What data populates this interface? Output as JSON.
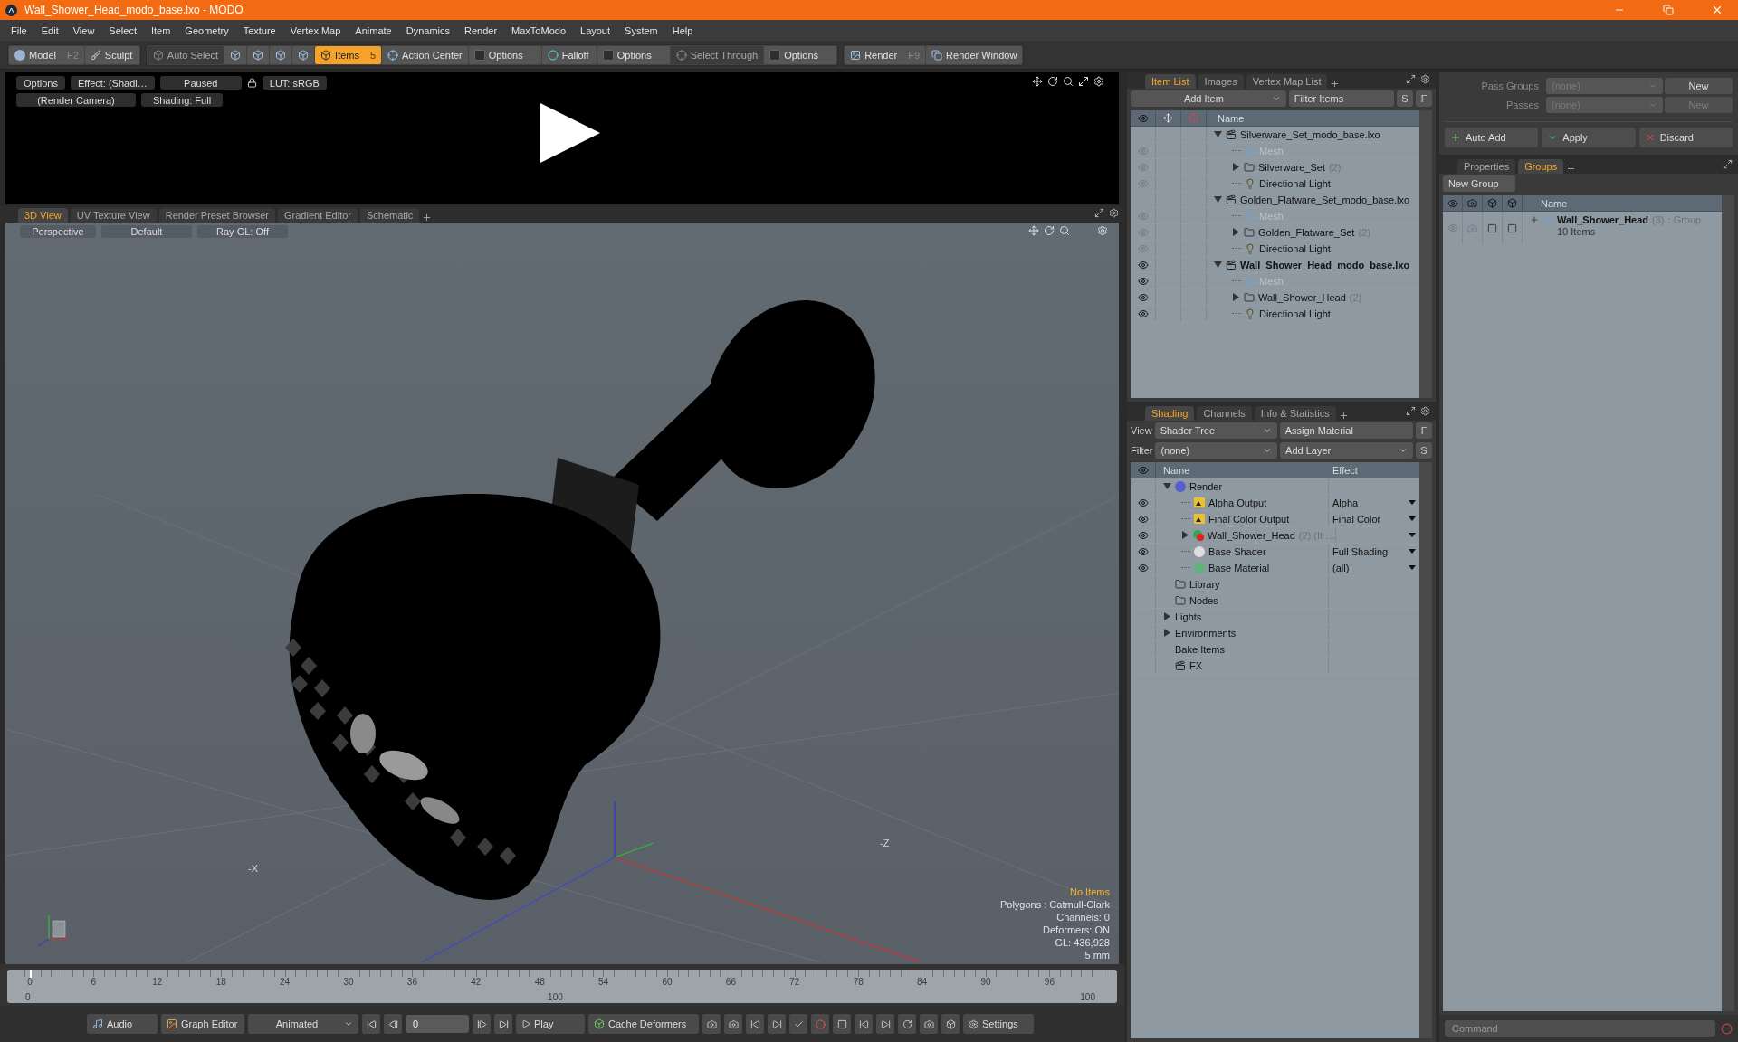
{
  "window": {
    "title": "Wall_Shower_Head_modo_base.lxo - MODO"
  },
  "menu": [
    "File",
    "Edit",
    "View",
    "Select",
    "Item",
    "Geometry",
    "Texture",
    "Vertex Map",
    "Animate",
    "Dynamics",
    "Render",
    "MaxToModo",
    "Layout",
    "System",
    "Help"
  ],
  "toolbar": [
    [
      {
        "kind": "mode",
        "label": "Model",
        "shortcut": "F2",
        "selected": false,
        "disabled": false
      },
      {
        "kind": "brush",
        "label": "Sculpt",
        "selected": false,
        "disabled": false
      }
    ],
    [
      {
        "kind": "auto-select",
        "label": "Auto Select",
        "selected": false,
        "disabled": true
      },
      {
        "kind": "vertex",
        "selected": false,
        "disabled": false
      },
      {
        "kind": "edge",
        "selected": false,
        "disabled": false
      },
      {
        "kind": "polygon",
        "selected": false,
        "disabled": false
      },
      {
        "kind": "material",
        "selected": false,
        "disabled": false
      },
      {
        "kind": "items",
        "label": "Items",
        "shortcut": "5",
        "selected": true,
        "disabled": false
      },
      {
        "kind": "action-center",
        "label": "Action Center",
        "selected": false,
        "disabled": false
      },
      {
        "kind": "options",
        "label": "Options",
        "selected": false,
        "disabled": false
      },
      {
        "kind": "falloff",
        "label": "Falloff",
        "selected": false,
        "disabled": false
      },
      {
        "kind": "options",
        "label": "Options",
        "selected": false,
        "disabled": false
      },
      {
        "kind": "select-through",
        "label": "Select Through",
        "selected": false,
        "disabled": true
      },
      {
        "kind": "options",
        "label": "Options",
        "selected": false,
        "disabled": false
      }
    ],
    [
      {
        "kind": "render",
        "label": "Render",
        "shortcut": "F9",
        "selected": false,
        "disabled": false
      },
      {
        "kind": "render-window",
        "label": "Render Window",
        "selected": false,
        "disabled": false
      }
    ]
  ],
  "preview": {
    "top_buttons": [
      "Options",
      "Effect: (Shadi…",
      "Paused",
      "LUT: sRGB"
    ],
    "bottom_buttons": [
      "(Render Camera)",
      "Shading: Full"
    ]
  },
  "viewport_tabs": [
    {
      "label": "3D View",
      "selected": true
    },
    {
      "label": "UV Texture View",
      "selected": false
    },
    {
      "label": "Render Preset Browser",
      "selected": false
    },
    {
      "label": "Gradient Editor",
      "selected": false
    },
    {
      "label": "Schematic",
      "selected": false
    }
  ],
  "viewport": {
    "buttons": [
      "Perspective",
      "Default",
      "Ray GL: Off"
    ],
    "axis_labels": [
      "-X",
      "-Z"
    ],
    "stats": [
      {
        "kind": "warning",
        "text": "No Items"
      },
      {
        "kind": "info",
        "text": "Polygons : Catmull-Clark"
      },
      {
        "kind": "info",
        "text": "Channels: 0"
      },
      {
        "kind": "info",
        "text": "Deformers: ON"
      },
      {
        "kind": "info",
        "text": "GL: 436,928"
      },
      {
        "kind": "info",
        "text": "5 mm"
      }
    ]
  },
  "timeline": {
    "ticks": [
      "0",
      "6",
      "12",
      "18",
      "24",
      "30",
      "36",
      "42",
      "48",
      "54",
      "60",
      "66",
      "72",
      "78",
      "84",
      "90",
      "96"
    ],
    "lower_ticks": [
      "0",
      "100",
      "100"
    ]
  },
  "bottom_bar": {
    "audio": "Audio",
    "graph_editor": "Graph Editor",
    "mode": "Animated",
    "frame": "0",
    "play": "Play",
    "cache": "Cache Deformers",
    "settings": "Settings"
  },
  "item_list": {
    "tabs": [
      {
        "label": "Item List",
        "selected": true
      },
      {
        "label": "Images",
        "selected": false
      },
      {
        "label": "Vertex Map List",
        "selected": false
      }
    ],
    "add_item": "Add Item",
    "filter": "Filter Items",
    "s": "S",
    "f": "F",
    "column": "Name",
    "items": [
      {
        "kind": "scene",
        "label": "Silverware_Set_modo_base.lxo",
        "current": false,
        "expanded": true,
        "children": [
          {
            "kind": "mesh",
            "label": "Mesh",
            "visible": false,
            "disabled": true
          },
          {
            "kind": "group",
            "label": "Silverware_Set",
            "count": "(2)",
            "visible": false,
            "disabled": false,
            "expanded": false
          },
          {
            "kind": "light",
            "label": "Directional Light",
            "visible": false,
            "disabled": false
          }
        ]
      },
      {
        "kind": "scene",
        "label": "Golden_Flatware_Set_modo_base.lxo",
        "current": false,
        "expanded": true,
        "children": [
          {
            "kind": "mesh",
            "label": "Mesh",
            "visible": false,
            "disabled": true
          },
          {
            "kind": "group",
            "label": "Golden_Flatware_Set",
            "count": "(2)",
            "visible": false,
            "disabled": false,
            "expanded": false
          },
          {
            "kind": "light",
            "label": "Directional Light",
            "visible": false,
            "disabled": false
          }
        ]
      },
      {
        "kind": "scene",
        "label": "Wall_Shower_Head_modo_base.lxo",
        "visible": true,
        "current": true,
        "expanded": true,
        "children": [
          {
            "kind": "mesh",
            "label": "Mesh",
            "visible": true,
            "disabled": true
          },
          {
            "kind": "group",
            "label": "Wall_Shower_Head",
            "count": "(2)",
            "visible": true,
            "disabled": false,
            "expanded": false
          },
          {
            "kind": "light",
            "label": "Directional Light",
            "visible": true,
            "disabled": false
          }
        ]
      }
    ]
  },
  "shading": {
    "tabs": [
      {
        "label": "Shading",
        "selected": true
      },
      {
        "label": "Channels",
        "selected": false
      },
      {
        "label": "Info & Statistics",
        "selected": false
      }
    ],
    "view_label": "View",
    "view": "Shader Tree",
    "assign": "Assign Material",
    "f": "F",
    "filter_label": "Filter",
    "filter": "(none)",
    "add_layer": "Add Layer",
    "s": "S",
    "columns": [
      "Name",
      "Effect"
    ],
    "items": [
      {
        "kind": "render",
        "label": "Render",
        "eye": false,
        "has_menu": false,
        "expanded": true,
        "children": [
          {
            "kind": "output",
            "label": "Alpha Output",
            "effect": "Alpha",
            "eye": true,
            "has_menu": true
          },
          {
            "kind": "output",
            "label": "Final Color Output",
            "effect": "Final Color",
            "eye": true,
            "has_menu": true
          },
          {
            "kind": "material-group",
            "label": "Wall_Shower_Head",
            "count": "(2) (It …",
            "eye": true,
            "has_menu": true,
            "expanded": false
          },
          {
            "kind": "shader",
            "label": "Base Shader",
            "effect": "Full Shading",
            "eye": true,
            "has_menu": true
          },
          {
            "kind": "material",
            "label": "Base Material",
            "effect": "(all)",
            "eye": true,
            "has_menu": true
          }
        ]
      },
      {
        "kind": "folder",
        "label": "Library",
        "eye": false,
        "has_menu": false
      },
      {
        "kind": "folder",
        "label": "Nodes",
        "eye": false,
        "has_menu": false
      },
      {
        "kind": "plain",
        "label": "Lights",
        "eye": false,
        "has_menu": false,
        "expanded": false
      },
      {
        "kind": "plain",
        "label": "Environments",
        "eye": false,
        "has_menu": false,
        "expanded": false
      },
      {
        "kind": "plain",
        "label": "Bake Items",
        "eye": false,
        "has_menu": false
      },
      {
        "kind": "fx",
        "label": "FX",
        "eye": false,
        "has_menu": false
      }
    ]
  },
  "passes": {
    "pass_groups_label": "Pass Groups",
    "pass_groups": "(none)",
    "pass_groups_new": "New",
    "passes_label": "Passes",
    "passes": "(none)",
    "passes_new": "New",
    "passes_disabled": true
  },
  "actions": [
    {
      "kind": "add",
      "label": "Auto Add"
    },
    {
      "kind": "apply",
      "label": "Apply"
    },
    {
      "kind": "discard",
      "label": "Discard"
    }
  ],
  "groups": {
    "tabs": [
      {
        "label": "Properties",
        "selected": false
      },
      {
        "label": "Groups",
        "selected": true
      }
    ],
    "new_group": "New Group",
    "column": "Name",
    "items": [
      {
        "name": "Wall_Shower_Head",
        "count": "(3)",
        "type": ": Group",
        "detail": "10 Items"
      }
    ]
  },
  "command": {
    "placeholder": "Command"
  }
}
